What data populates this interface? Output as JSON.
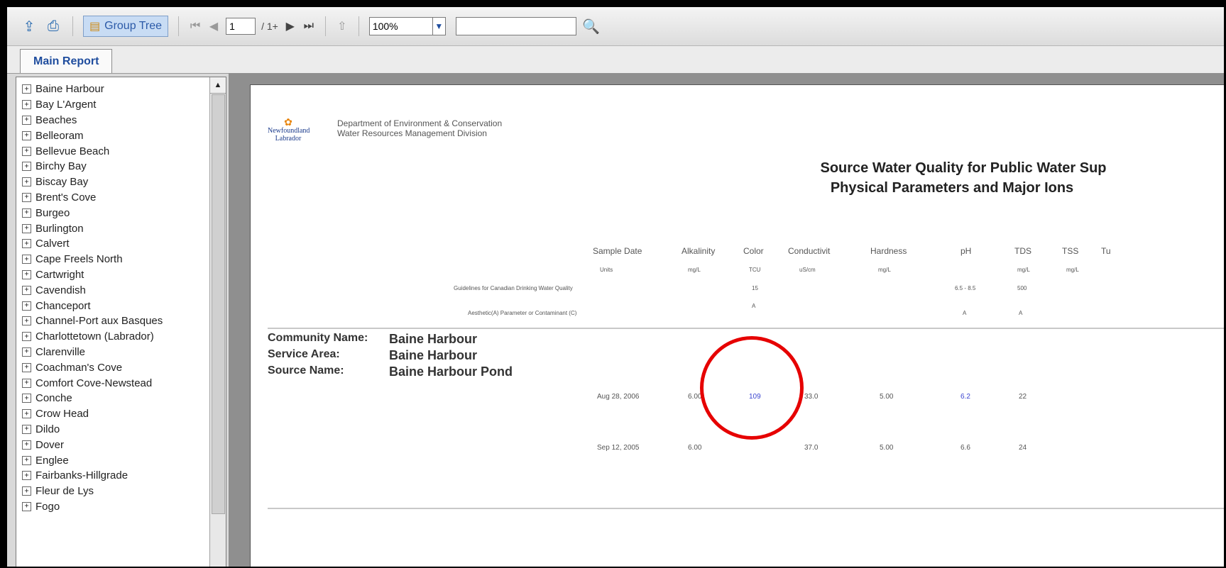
{
  "toolbar": {
    "group_tree_label": "Group Tree",
    "page_current": "1",
    "page_total": "/ 1+",
    "zoom_value": "100%",
    "search_value": ""
  },
  "tabs": [
    {
      "label": "Main Report"
    }
  ],
  "tree": [
    {
      "label": "Baine Harbour"
    },
    {
      "label": "Bay L'Argent"
    },
    {
      "label": "Beaches"
    },
    {
      "label": "Belleoram"
    },
    {
      "label": "Bellevue Beach"
    },
    {
      "label": "Birchy Bay"
    },
    {
      "label": "Biscay Bay"
    },
    {
      "label": "Brent's Cove"
    },
    {
      "label": "Burgeo"
    },
    {
      "label": "Burlington"
    },
    {
      "label": "Calvert"
    },
    {
      "label": "Cape Freels North"
    },
    {
      "label": "Cartwright"
    },
    {
      "label": "Cavendish"
    },
    {
      "label": "Chanceport"
    },
    {
      "label": "Channel-Port aux Basques"
    },
    {
      "label": "Charlottetown (Labrador)"
    },
    {
      "label": "Clarenville"
    },
    {
      "label": "Coachman's Cove"
    },
    {
      "label": "Comfort Cove-Newstead"
    },
    {
      "label": "Conche"
    },
    {
      "label": "Crow Head"
    },
    {
      "label": "Dildo"
    },
    {
      "label": "Dover"
    },
    {
      "label": "Englee"
    },
    {
      "label": "Fairbanks-Hillgrade"
    },
    {
      "label": "Fleur de Lys"
    },
    {
      "label": "Fogo"
    }
  ],
  "report": {
    "logo_text": "Newfoundland Labrador",
    "dept_line1": "Department of Environment & Conservation",
    "dept_line2": "Water Resources Management Division",
    "title_line1": "Source Water Quality for Public Water Sup",
    "title_line2": "Physical Parameters and Major Ions",
    "columns": [
      "Sample Date",
      "Alkalinity",
      "Color",
      "Conductivit",
      "Hardness",
      "pH",
      "TDS",
      "TSS",
      "Tu"
    ],
    "units_label": "Units",
    "units": [
      "mg/L",
      "TCU",
      "uS/cm",
      "mg/L",
      "",
      "mg/L",
      "mg/L"
    ],
    "guidelines_label": "Guidelines for Canadian Drinking Water Quality",
    "guidelines": {
      "color": "15",
      "ph": "6.5 - 8.5",
      "tds": "500"
    },
    "param_label": "Aesthetic(A) Parameter or Contaminant (C)",
    "param_flags": {
      "color": "A",
      "ph": "A",
      "tds": "A"
    },
    "community_label": "Community Name:",
    "community_value": "Baine Harbour",
    "service_label": "Service Area:",
    "service_value": "Baine Harbour",
    "source_label": "Source Name:",
    "source_value": "Baine Harbour Pond",
    "rows": [
      {
        "date": "Aug 28, 2006",
        "alkalinity": "6.00",
        "color": "109",
        "conductivity": "33.0",
        "hardness": "5.00",
        "ph": "6.2",
        "tds": "22"
      },
      {
        "date": "Sep 12, 2005",
        "alkalinity": "6.00",
        "color": "",
        "conductivity": "37.0",
        "hardness": "5.00",
        "ph": "6.6",
        "tds": "24"
      }
    ]
  },
  "colors": {
    "annotation": "#e60000",
    "flagged_value": "#3c46d0"
  }
}
